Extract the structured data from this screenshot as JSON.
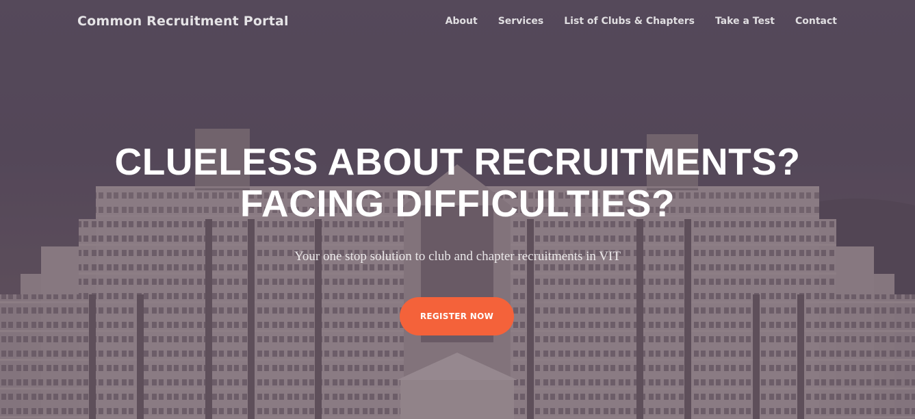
{
  "navbar": {
    "brand": "Common Recruitment Portal",
    "links": [
      "About",
      "Services",
      "List of Clubs & Chapters",
      "Take a Test",
      "Contact"
    ]
  },
  "hero": {
    "headline_line1": "CLUELESS ABOUT RECRUITMENTS?",
    "headline_line2": "FACING DIFFICULTIES?",
    "subtitle": "Your one stop solution to club and chapter recruitments in VIT",
    "cta_label": "REGISTER NOW"
  },
  "colors": {
    "accent": "#f4623a",
    "text": "#ffffff"
  }
}
